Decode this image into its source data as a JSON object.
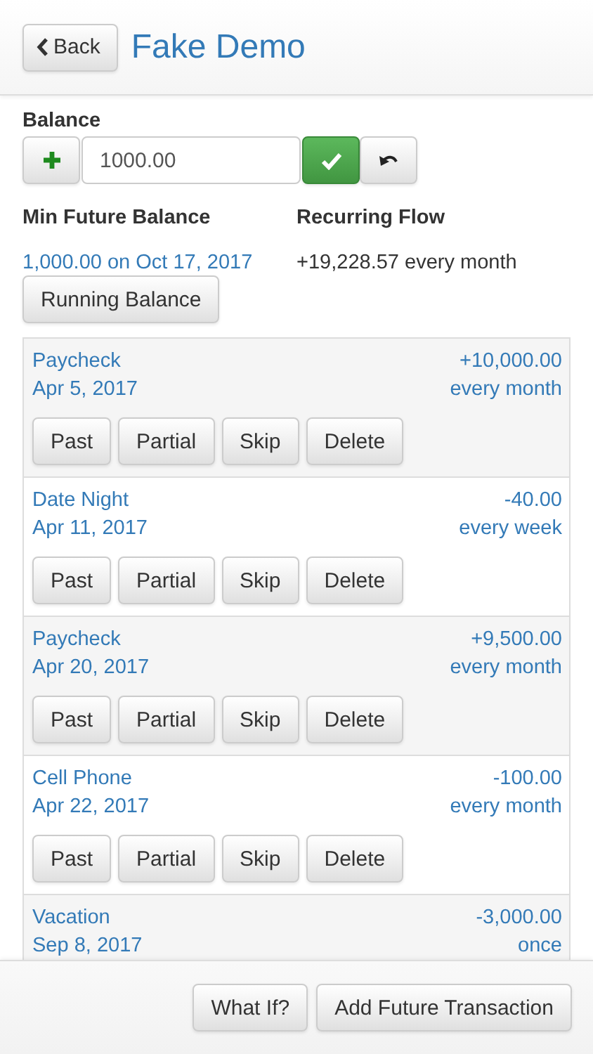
{
  "header": {
    "back_button": "Back",
    "title": "Fake Demo"
  },
  "balance": {
    "label": "Balance",
    "value": "1000.00"
  },
  "min_future_balance": {
    "label": "Min Future Balance",
    "value": "1,000.00 on Oct 17, 2017"
  },
  "recurring_flow": {
    "label": "Recurring Flow",
    "value": "+19,228.57 every month"
  },
  "running_balance_button": "Running Balance",
  "transactions": [
    {
      "name": "Paycheck",
      "date": "Apr 5, 2017",
      "amount": "+10,000.00",
      "frequency": "every month",
      "actions": [
        "Past",
        "Partial",
        "Skip",
        "Delete"
      ]
    },
    {
      "name": "Date Night",
      "date": "Apr 11, 2017",
      "amount": "-40.00",
      "frequency": "every week",
      "actions": [
        "Past",
        "Partial",
        "Skip",
        "Delete"
      ]
    },
    {
      "name": "Paycheck",
      "date": "Apr 20, 2017",
      "amount": "+9,500.00",
      "frequency": "every month",
      "actions": [
        "Past",
        "Partial",
        "Skip",
        "Delete"
      ]
    },
    {
      "name": "Cell Phone",
      "date": "Apr 22, 2017",
      "amount": "-100.00",
      "frequency": "every month",
      "actions": [
        "Past",
        "Partial",
        "Skip",
        "Delete"
      ]
    },
    {
      "name": "Vacation",
      "date": "Sep 8, 2017",
      "amount": "-3,000.00",
      "frequency": "once"
    }
  ],
  "footer_buttons": [
    "What If?",
    "Add Future Transaction"
  ]
}
